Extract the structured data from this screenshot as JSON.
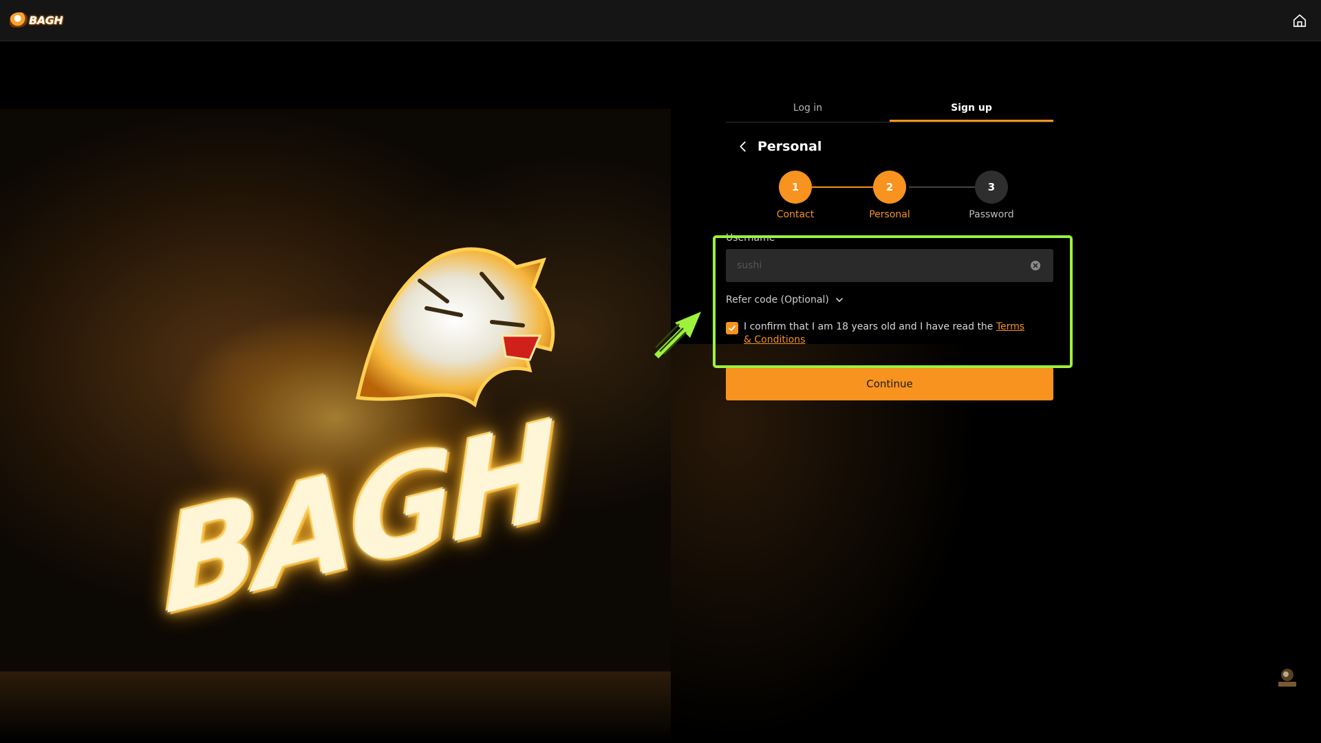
{
  "header": {
    "logo_text": "BAGH",
    "home_icon": "home-icon"
  },
  "hero": {
    "brand_text": "BAGH",
    "image_icon": "tiger-logo"
  },
  "auth": {
    "tabs": [
      {
        "label": "Log in",
        "active": false
      },
      {
        "label": "Sign up",
        "active": true
      }
    ],
    "heading": "Personal",
    "steps": [
      {
        "number": "1",
        "label": "Contact",
        "state": "done"
      },
      {
        "number": "2",
        "label": "Personal",
        "state": "active"
      },
      {
        "number": "3",
        "label": "Password",
        "state": "pending"
      }
    ],
    "username": {
      "label": "Username",
      "value": "sushi",
      "placeholder": ""
    },
    "refer_code_label": "Refer code (Optional)",
    "confirm": {
      "checked": true,
      "text": "I confirm that I am 18 years old and I have read the ",
      "link": "Terms & Conditions"
    },
    "continue_label": "Continue"
  },
  "colors": {
    "accent": "#f7931e",
    "highlight": "#9df23b",
    "topbar": "#151515",
    "input_bg": "#2a2a2a",
    "step_pending": "#2e2e2e"
  }
}
